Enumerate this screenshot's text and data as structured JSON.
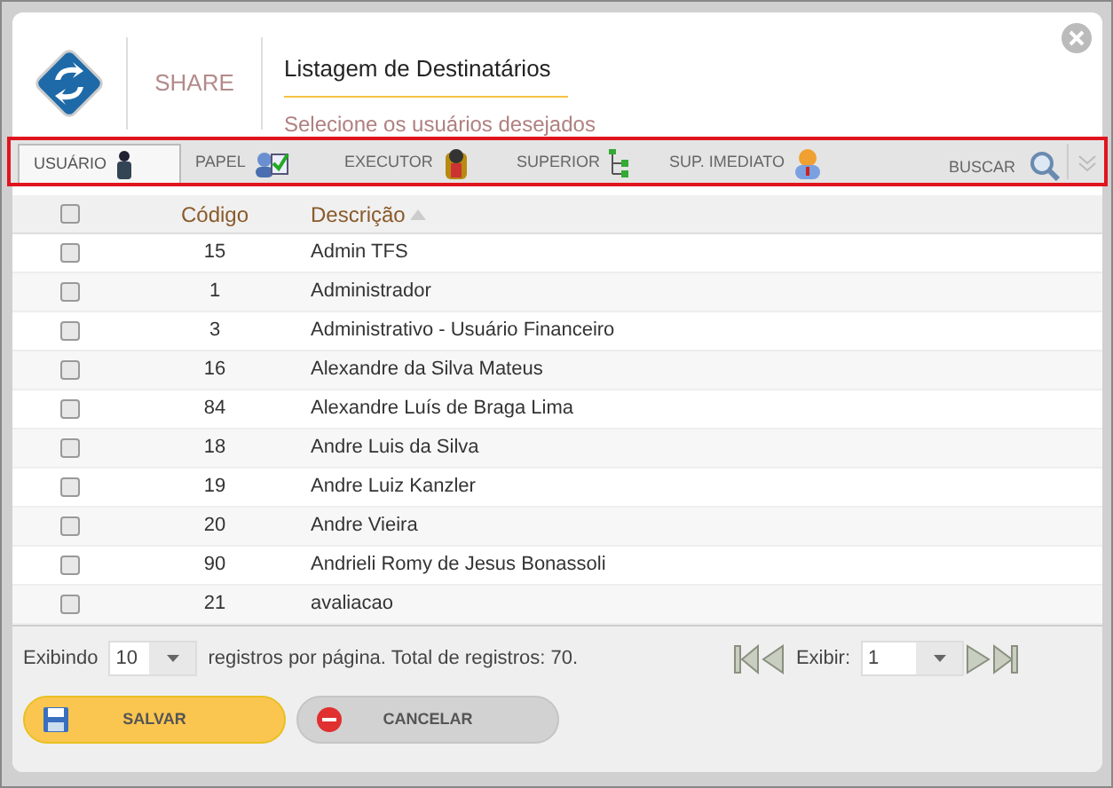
{
  "header": {
    "app": "SHARE",
    "title": "Listagem de Destinatários",
    "subtitle": "Selecione os usuários desejados"
  },
  "tabs": [
    {
      "label": "USUÁRIO",
      "kind": "user",
      "selected": true
    },
    {
      "label": "PAPEL",
      "kind": "role",
      "selected": false
    },
    {
      "label": "EXECUTOR",
      "kind": "executor",
      "selected": false
    },
    {
      "label": "SUPERIOR",
      "kind": "tree",
      "selected": false
    },
    {
      "label": "SUP. IMEDIATO",
      "kind": "boss",
      "selected": false
    }
  ],
  "search": {
    "label": "BUSCAR"
  },
  "table": {
    "select_all_checked": false,
    "columns": [
      "Código",
      "Descrição"
    ],
    "rows": [
      {
        "code": "15",
        "description": "Admin TFS",
        "checked": false
      },
      {
        "code": "1",
        "description": "Administrador",
        "checked": false
      },
      {
        "code": "3",
        "description": "Administrativo - Usuário Financeiro",
        "checked": false
      },
      {
        "code": "16",
        "description": "Alexandre da Silva Mateus",
        "checked": false
      },
      {
        "code": "84",
        "description": "Alexandre Luís de Braga Lima",
        "checked": false
      },
      {
        "code": "18",
        "description": "Andre Luis da Silva",
        "checked": false
      },
      {
        "code": "19",
        "description": "Andre Luiz Kanzler",
        "checked": false
      },
      {
        "code": "20",
        "description": "Andre Vieira",
        "checked": false
      },
      {
        "code": "90",
        "description": "Andrieli Romy de Jesus Bonassoli",
        "checked": false
      },
      {
        "code": "21",
        "description": "avaliacao",
        "checked": false
      }
    ]
  },
  "footer": {
    "showing": "Exibindo",
    "page_size": "10",
    "per_page_text": "registros por página. Total de registros:",
    "total": "70.",
    "page_label": "Exibir:",
    "page": "1"
  },
  "buttons": [
    {
      "label": "SALVAR",
      "kind": "save"
    },
    {
      "label": "CANCELAR",
      "kind": "cancel"
    }
  ]
}
